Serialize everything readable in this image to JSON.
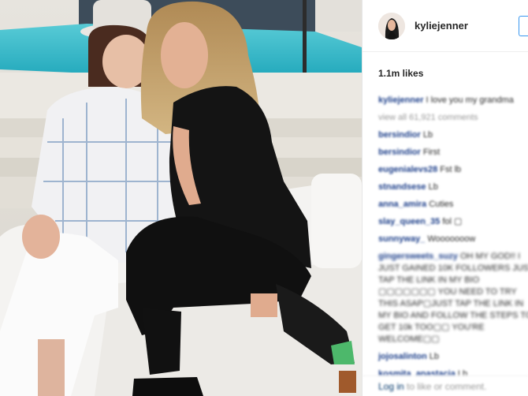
{
  "post": {
    "username": "kyliejenner",
    "likes": "1.1m likes",
    "caption_user": "kyliejenner",
    "caption_text": "I love you my grandma",
    "view_all": "view all 61,921 comments"
  },
  "comments": [
    {
      "user": "bersindior",
      "text": "Lb"
    },
    {
      "user": "bersindior",
      "text": "First"
    },
    {
      "user": "eugenialevs28",
      "text": "Fst lb"
    },
    {
      "user": "stnandsese",
      "text": "Lb"
    },
    {
      "user": "anna_amira",
      "text": "Cuties"
    },
    {
      "user": "slay_queen_35",
      "text": "fol ▢"
    },
    {
      "user": "sunnyway_",
      "text": "Wooooooow"
    },
    {
      "user": "gingersweets_suzy",
      "text": "OH MY GOD!! I JUST GAINED 10K FOLLOWERS JUST TAP THE LINK IN MY BIO ▢▢▢▢▢▢▢ YOU NEED TO TRY THIS ASAP▢JUST TAP THE LINK IN MY BIO AND FOLLOW THE STEPS TO GET 10k TOO▢▢ YOU'RE WELCOME▢▢"
    },
    {
      "user": "jojosalinton",
      "text": "Lb"
    },
    {
      "user": "kosmita_anastacia",
      "text": "Lb"
    }
  ],
  "footer": {
    "login": "Log in",
    "rest": "to like or comment."
  },
  "colors": {
    "link": "#003569",
    "follow_border": "#3897f0",
    "pool": "#2fb7c6"
  },
  "icons": {
    "follow": "follow-button"
  }
}
